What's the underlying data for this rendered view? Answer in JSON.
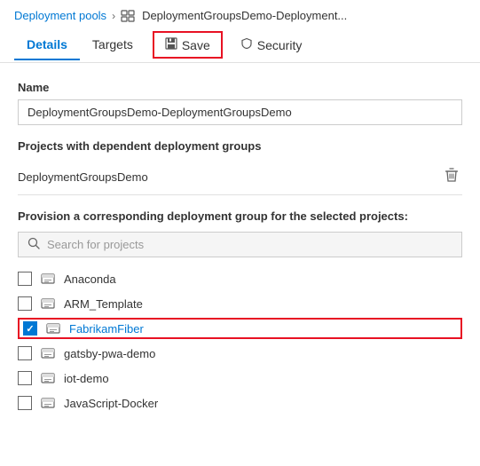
{
  "breadcrumb": {
    "parent": "Deployment pools",
    "current": "DeploymentGroupsDemo-Deployment...",
    "icon": "⊞"
  },
  "tabs": [
    {
      "id": "details",
      "label": "Details",
      "active": true
    },
    {
      "id": "targets",
      "label": "Targets",
      "active": false
    }
  ],
  "save_button": {
    "label": "Save",
    "icon": "💾"
  },
  "security_tab": {
    "label": "Security",
    "icon": "🛡"
  },
  "name_field": {
    "label": "Name",
    "value": "DeploymentGroupsDemo-DeploymentGroupsDemo",
    "placeholder": ""
  },
  "dependent_section": {
    "title": "Projects with dependent deployment groups",
    "group_name": "DeploymentGroupsDemo"
  },
  "provision_section": {
    "label": "Provision a corresponding deployment group for the selected projects:",
    "search_placeholder": "Search for projects",
    "projects": [
      {
        "id": "anaconda",
        "name": "Anaconda",
        "checked": false,
        "highlighted": false
      },
      {
        "id": "arm-template",
        "name": "ARM_Template",
        "checked": false,
        "highlighted": false
      },
      {
        "id": "fabrikam-fiber",
        "name": "FabrikamFiber",
        "checked": true,
        "highlighted": true
      },
      {
        "id": "gatsby-pwa-demo",
        "name": "gatsby-pwa-demo",
        "checked": false,
        "highlighted": false
      },
      {
        "id": "iot-demo",
        "name": "iot-demo",
        "checked": false,
        "highlighted": false
      },
      {
        "id": "javascript-docker",
        "name": "JavaScript-Docker",
        "checked": false,
        "highlighted": false
      }
    ]
  }
}
